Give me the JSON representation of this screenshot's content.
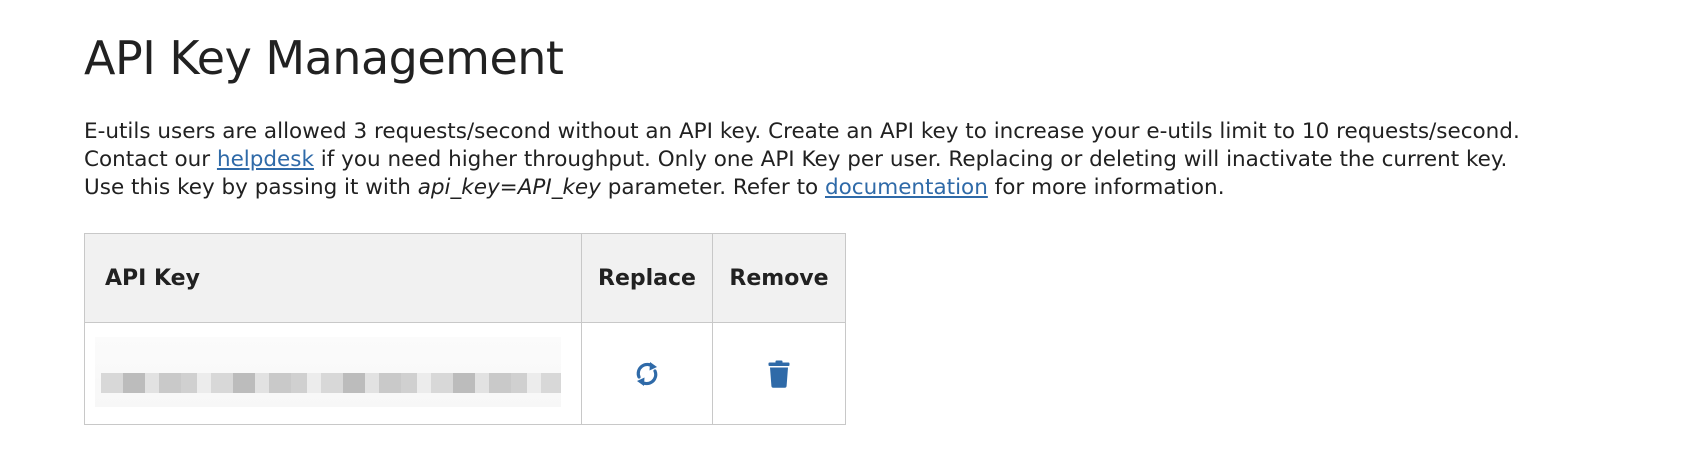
{
  "page": {
    "title": "API Key Management",
    "description": {
      "part1": "E-utils users are allowed 3 requests/second without an API key. Create an API key to increase your e-utils limit to 10 requests/second. Contact our ",
      "helpdesk_link": "helpdesk",
      "part2": " if you need higher throughput. Only one API Key per user. Replacing or deleting will inactivate the current key. Use this key by passing it with ",
      "param_example": "api_key=API_key",
      "part3": " parameter. Refer to ",
      "documentation_link": "documentation",
      "part4": " for more information."
    }
  },
  "table": {
    "headers": {
      "api_key": "API Key",
      "replace": "Replace",
      "remove": "Remove"
    },
    "rows": [
      {
        "api_key_masked": true,
        "replace_icon": "refresh-icon",
        "remove_icon": "trash-icon"
      }
    ]
  },
  "colors": {
    "link": "#2f6aa8",
    "icon": "#2f6aa8",
    "header_bg": "#f1f1f1",
    "border": "#c8c8c8"
  }
}
